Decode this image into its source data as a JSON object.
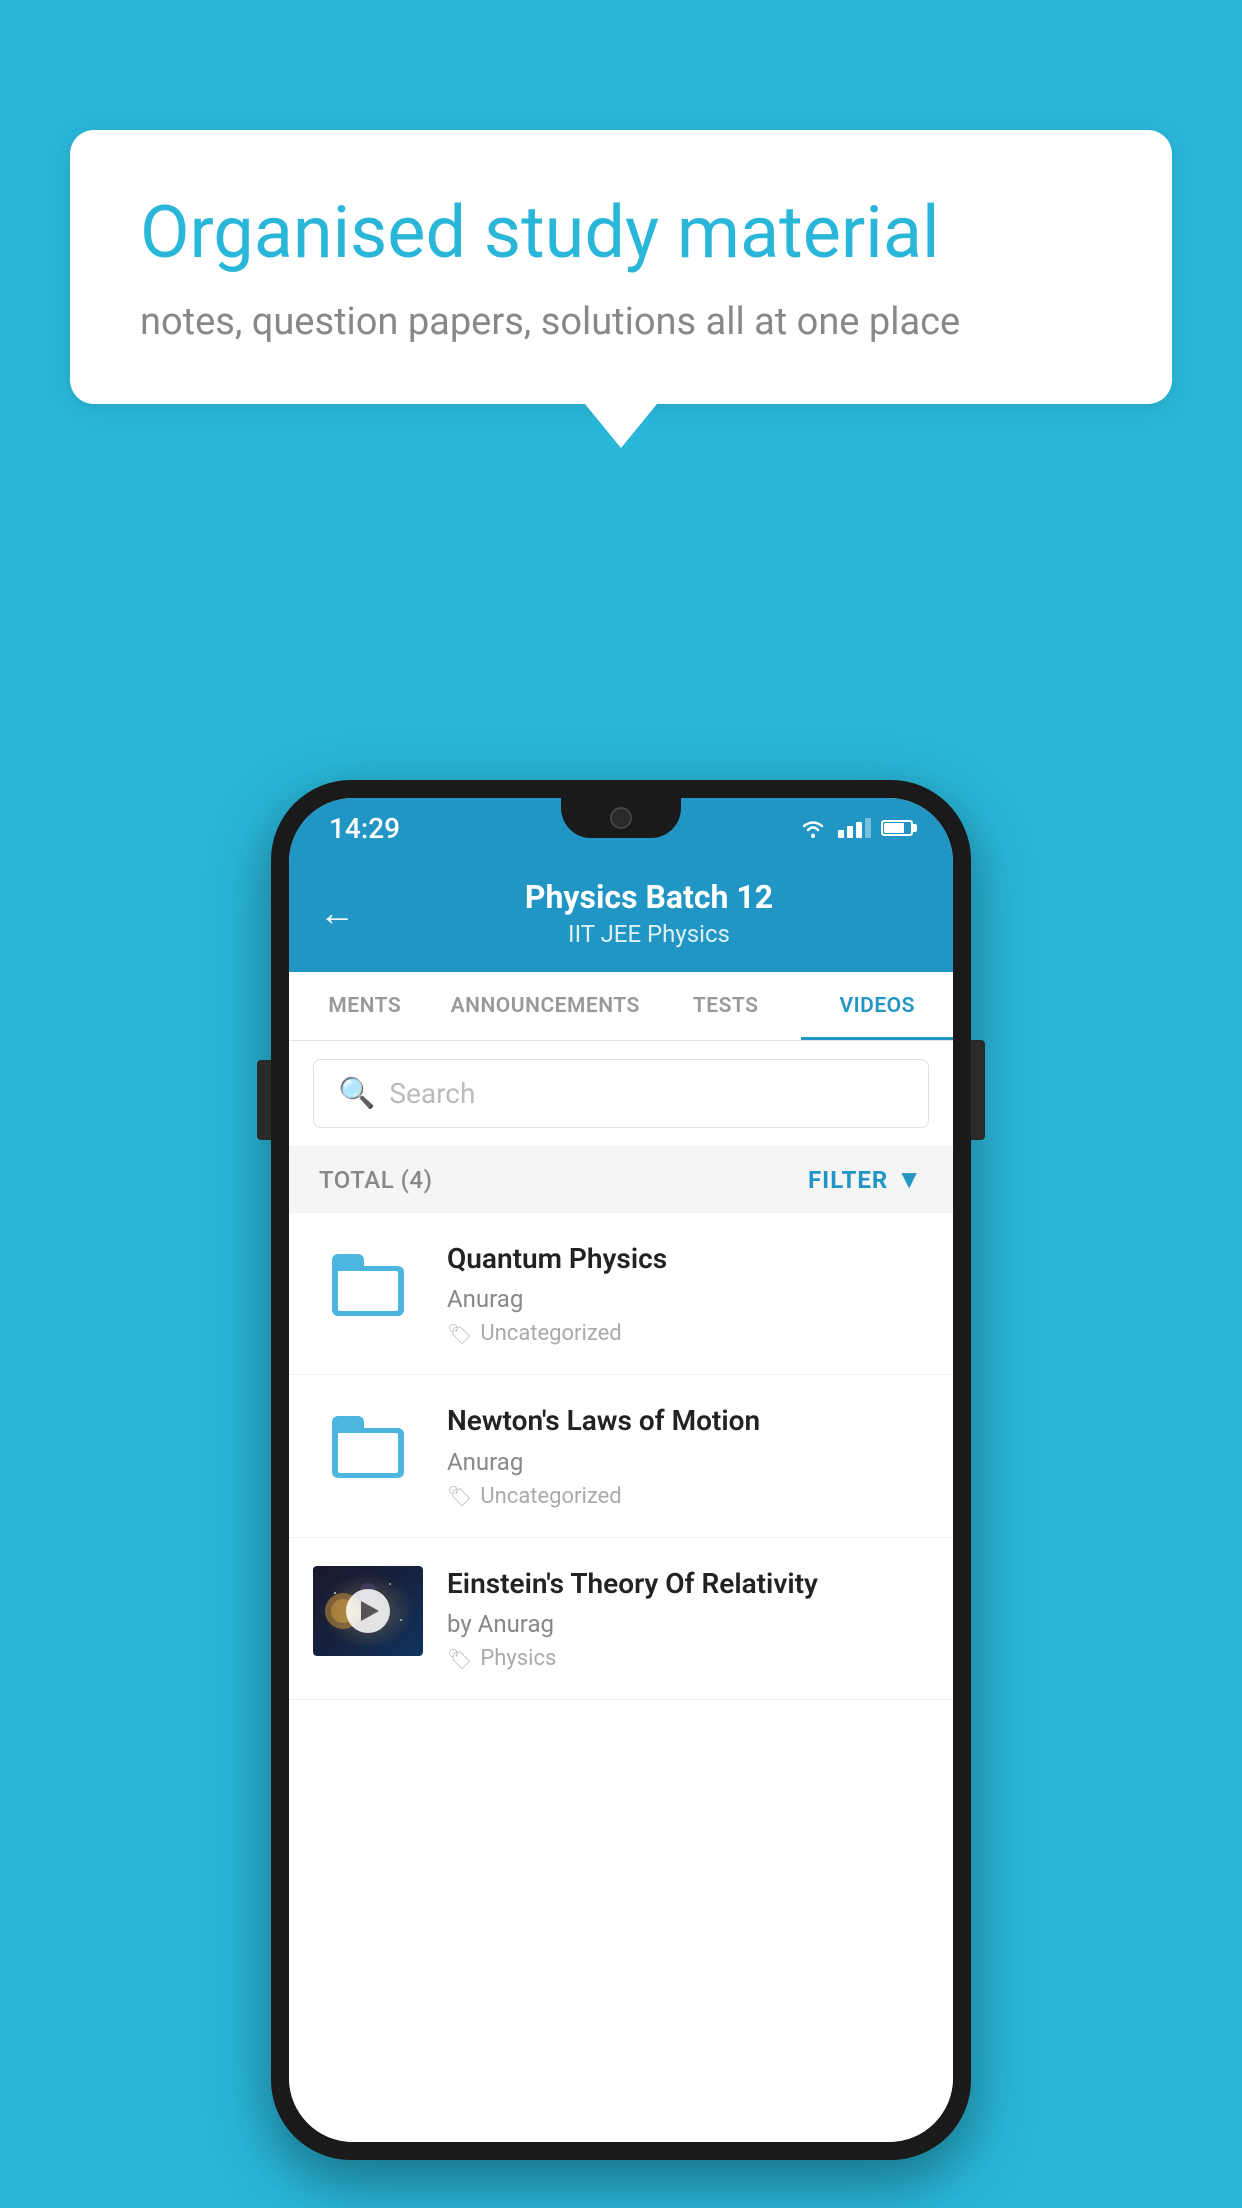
{
  "background": {
    "color": "#29b6d8"
  },
  "speech_bubble": {
    "title": "Organised study material",
    "subtitle": "notes, question papers, solutions all at one place"
  },
  "phone": {
    "status_bar": {
      "time": "14:29"
    },
    "app_header": {
      "title": "Physics Batch 12",
      "subtitle": "IIT JEE   Physics",
      "back_label": "←"
    },
    "tabs": [
      {
        "label": "MENTS",
        "active": false
      },
      {
        "label": "ANNOUNCEMENTS",
        "active": false
      },
      {
        "label": "TESTS",
        "active": false
      },
      {
        "label": "VIDEOS",
        "active": true
      }
    ],
    "search": {
      "placeholder": "Search"
    },
    "filter_row": {
      "total_label": "TOTAL (4)",
      "filter_label": "FILTER"
    },
    "videos": [
      {
        "title": "Quantum Physics",
        "author": "Anurag",
        "tag": "Uncategorized",
        "has_thumb": false
      },
      {
        "title": "Newton's Laws of Motion",
        "author": "Anurag",
        "tag": "Uncategorized",
        "has_thumb": false
      },
      {
        "title": "Einstein's Theory Of Relativity",
        "author": "by Anurag",
        "tag": "Physics",
        "has_thumb": true
      }
    ]
  }
}
